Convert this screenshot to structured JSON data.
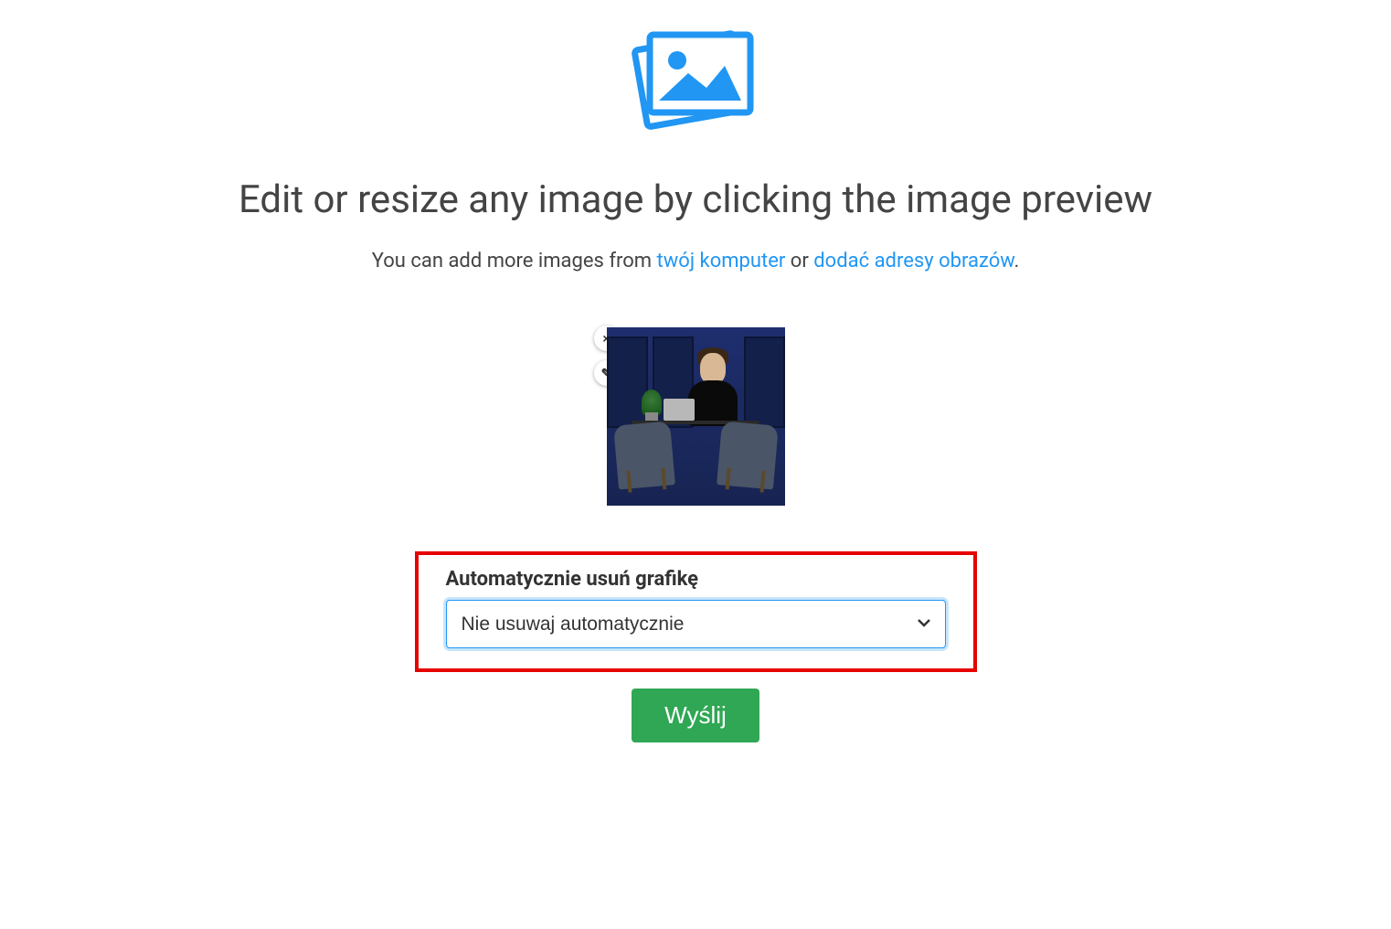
{
  "header": {
    "title": "Edit or resize any image by clicking the image preview",
    "subtitle_prefix": "You can add more images from ",
    "subtitle_link_computer": "twój komputer",
    "subtitle_mid": " or ",
    "subtitle_link_urls": "dodać adresy obrazów",
    "subtitle_suffix": "."
  },
  "thumbnail": {
    "icons": {
      "remove": "×",
      "edit": "✎"
    }
  },
  "auto_delete": {
    "label": "Automatycznie usuń grafikę",
    "selected": "Nie usuwaj automatycznie"
  },
  "submit": {
    "label": "Wyślij"
  },
  "colors": {
    "accent": "#2196F3",
    "highlight_border": "#e60000",
    "submit_bg": "#2fa754"
  }
}
